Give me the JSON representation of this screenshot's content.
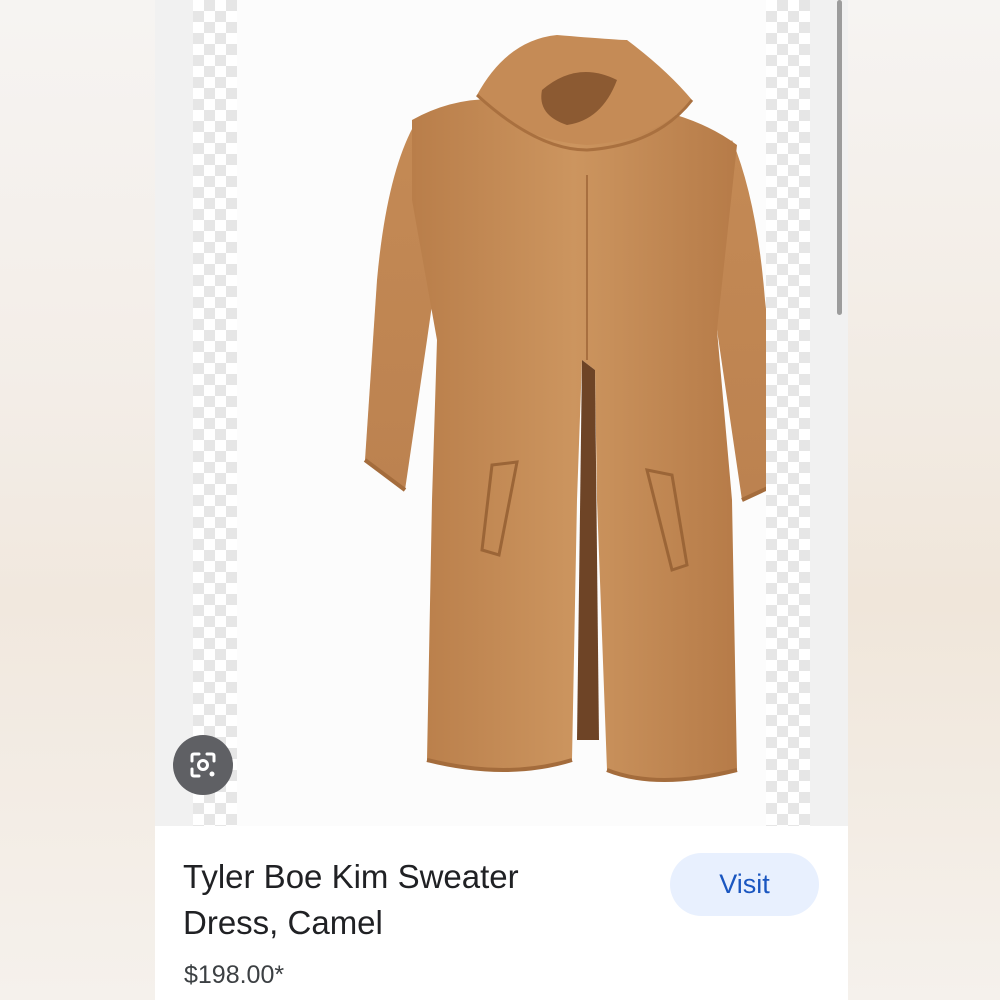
{
  "product": {
    "title": "Tyler Boe Kim Sweater Dress, Camel",
    "price": "$198.00*",
    "image_color": "#c8915c"
  },
  "actions": {
    "visit_label": "Visit",
    "lens_icon": "google-lens-icon"
  },
  "colors": {
    "accent": "#1a56c0",
    "button_bg": "#e8f0fe",
    "text": "#202124"
  }
}
